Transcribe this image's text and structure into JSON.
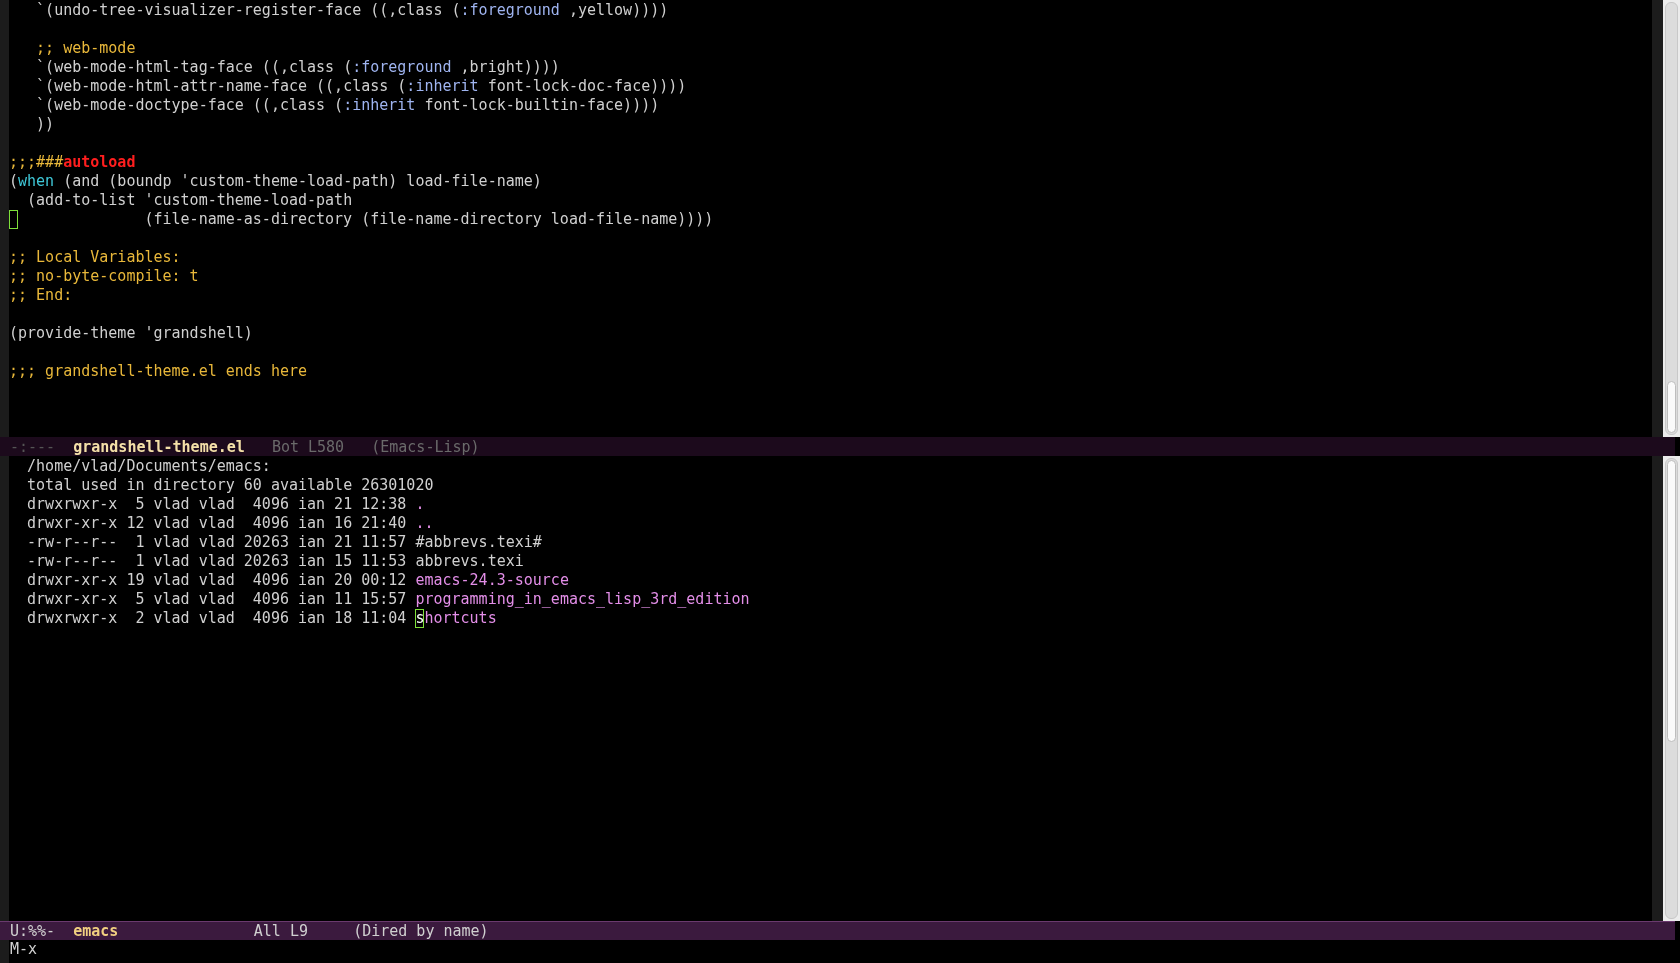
{
  "top_window": {
    "lines": [
      {
        "kind": "code",
        "segments": [
          {
            "kind": "plain",
            "text": "   `(undo-tree-visualizer-register-face ((,class ("
          },
          {
            "kind": "keyword",
            "text": ":foreground"
          },
          {
            "kind": "plain",
            "text": " ,yellow))))"
          }
        ]
      },
      {
        "kind": "blank"
      },
      {
        "kind": "code",
        "segments": [
          {
            "kind": "comment",
            "text": "   ;; web-mode"
          }
        ]
      },
      {
        "kind": "code",
        "segments": [
          {
            "kind": "plain",
            "text": "   `(web-mode-html-tag-face ((,class ("
          },
          {
            "kind": "keyword",
            "text": ":foreground"
          },
          {
            "kind": "plain",
            "text": " ,bright))))"
          }
        ]
      },
      {
        "kind": "code",
        "segments": [
          {
            "kind": "plain",
            "text": "   `(web-mode-html-attr-name-face ((,class ("
          },
          {
            "kind": "keyword",
            "text": ":inherit"
          },
          {
            "kind": "plain",
            "text": " font-lock-doc-face))))"
          }
        ]
      },
      {
        "kind": "code",
        "segments": [
          {
            "kind": "plain",
            "text": "   `(web-mode-doctype-face ((,class ("
          },
          {
            "kind": "keyword",
            "text": ":inherit"
          },
          {
            "kind": "plain",
            "text": " font-lock-builtin-face))))"
          }
        ]
      },
      {
        "kind": "code",
        "segments": [
          {
            "kind": "plain",
            "text": "   ))"
          }
        ]
      },
      {
        "kind": "blank"
      },
      {
        "kind": "code",
        "segments": [
          {
            "kind": "comment",
            "text": ";;;###"
          },
          {
            "kind": "warning",
            "text": "autoload"
          }
        ]
      },
      {
        "kind": "code",
        "segments": [
          {
            "kind": "plain",
            "text": "("
          },
          {
            "kind": "builtin",
            "text": "when"
          },
          {
            "kind": "plain",
            "text": " (and (boundp 'custom-theme-load-path) load-file-name)"
          }
        ]
      },
      {
        "kind": "code",
        "segments": [
          {
            "kind": "plain",
            "text": "  (add-to-list 'custom-theme-load-path"
          }
        ]
      },
      {
        "kind": "code",
        "cursor": true,
        "segments": [
          {
            "kind": "plain",
            "text": "              (file-name-as-directory (file-name-directory load-file-name))))"
          }
        ]
      },
      {
        "kind": "blank"
      },
      {
        "kind": "code",
        "segments": [
          {
            "kind": "comment",
            "text": ";; Local Variables:"
          }
        ]
      },
      {
        "kind": "code",
        "segments": [
          {
            "kind": "comment",
            "text": ";; no-byte-compile: t"
          }
        ]
      },
      {
        "kind": "code",
        "segments": [
          {
            "kind": "comment",
            "text": ";; End:"
          }
        ]
      },
      {
        "kind": "blank"
      },
      {
        "kind": "code",
        "segments": [
          {
            "kind": "plain",
            "text": "(provide-theme 'grandshell)"
          }
        ]
      },
      {
        "kind": "blank"
      },
      {
        "kind": "code",
        "segments": [
          {
            "kind": "comment",
            "text": ";;; grandshell-theme.el ends here"
          }
        ]
      }
    ],
    "mode_line": {
      "active": false,
      "status": "-:---",
      "buffer_name": "grandshell-theme.el",
      "position": "Bot L580",
      "mode": "(Emacs-Lisp)"
    }
  },
  "bottom_window": {
    "lines": [
      {
        "kind": "code",
        "segments": [
          {
            "kind": "plain",
            "text": "  /home/vlad/Documents/emacs:"
          }
        ]
      },
      {
        "kind": "code",
        "segments": [
          {
            "kind": "plain",
            "text": "  total used in directory 60 available 26301020"
          }
        ]
      },
      {
        "kind": "code",
        "segments": [
          {
            "kind": "plain",
            "text": "  drwxrwxr-x  5 vlad vlad  4096 ian 21 12:38 "
          },
          {
            "kind": "dir",
            "text": "."
          }
        ]
      },
      {
        "kind": "code",
        "segments": [
          {
            "kind": "plain",
            "text": "  drwxr-xr-x 12 vlad vlad  4096 ian 16 21:40 "
          },
          {
            "kind": "dir",
            "text": ".."
          }
        ]
      },
      {
        "kind": "code",
        "segments": [
          {
            "kind": "plain",
            "text": "  -rw-r--r--  1 vlad vlad 20263 ian 21 11:57 #abbrevs.texi#"
          }
        ]
      },
      {
        "kind": "code",
        "segments": [
          {
            "kind": "plain",
            "text": "  -rw-r--r--  1 vlad vlad 20263 ian 15 11:53 abbrevs.texi"
          }
        ]
      },
      {
        "kind": "code",
        "segments": [
          {
            "kind": "plain",
            "text": "  drwxr-xr-x 19 vlad vlad  4096 ian 20 00:12 "
          },
          {
            "kind": "dir",
            "text": "emacs-24.3-source"
          }
        ]
      },
      {
        "kind": "code",
        "segments": [
          {
            "kind": "plain",
            "text": "  drwxr-xr-x  5 vlad vlad  4096 ian 11 15:57 "
          },
          {
            "kind": "dir",
            "text": "programming_in_emacs_lisp_3rd_edition"
          }
        ]
      },
      {
        "kind": "code",
        "segments": [
          {
            "kind": "plain",
            "text": "  drwxrwxr-x  2 vlad vlad  4096 ian 18 11:04 "
          },
          {
            "kind": "cursor",
            "text": "s"
          },
          {
            "kind": "dir",
            "text": "hortcuts"
          }
        ]
      }
    ],
    "mode_line": {
      "active": true,
      "status": "U:%%-",
      "buffer_name": "emacs",
      "position": "All L9",
      "mode": "(Dired by name)"
    }
  },
  "minibuffer": {
    "text": "M-x"
  }
}
